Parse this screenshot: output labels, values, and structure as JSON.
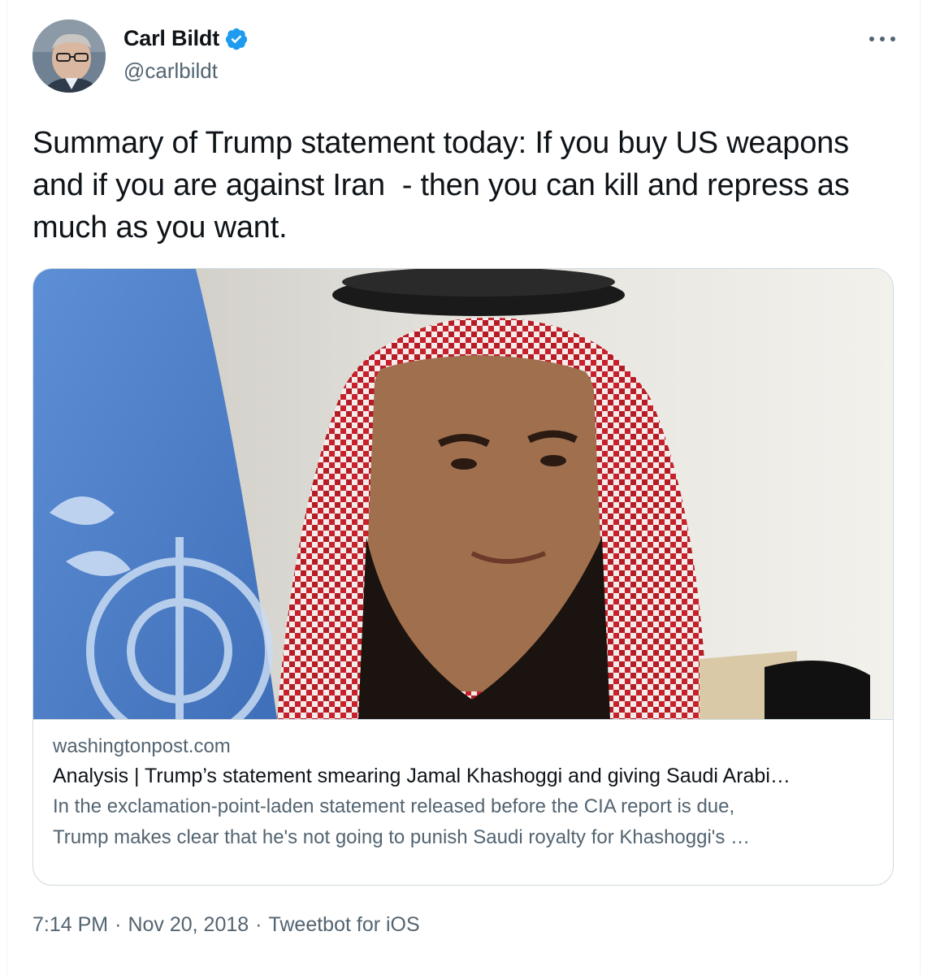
{
  "author": {
    "display_name": "Carl Bildt",
    "handle": "@carlbildt",
    "verified": true,
    "avatar_icon": "user-avatar"
  },
  "tweet": {
    "text": "Summary of Trump statement today: If you buy US weapons and if you are against Iran  - then you can kill and repress as much as you want."
  },
  "link_card": {
    "domain": "washingtonpost.com",
    "title": "Analysis | Trump’s statement smearing Jamal Khashoggi and giving Saudi Arabi…",
    "description_lines": [
      "In the exclamation-point-laden statement released before the CIA report is due,",
      "Trump makes clear that he's not going to punish Saudi royalty for Khashoggi's …"
    ],
    "image_icon": "article-photo"
  },
  "meta": {
    "time": "7:14 PM",
    "separator": "·",
    "date": "Nov 20, 2018",
    "source": "Tweetbot for iOS"
  },
  "colors": {
    "text_primary": "#0f1419",
    "text_secondary": "#536471",
    "verified_blue": "#1d9bf0",
    "border": "#cfd9de"
  }
}
